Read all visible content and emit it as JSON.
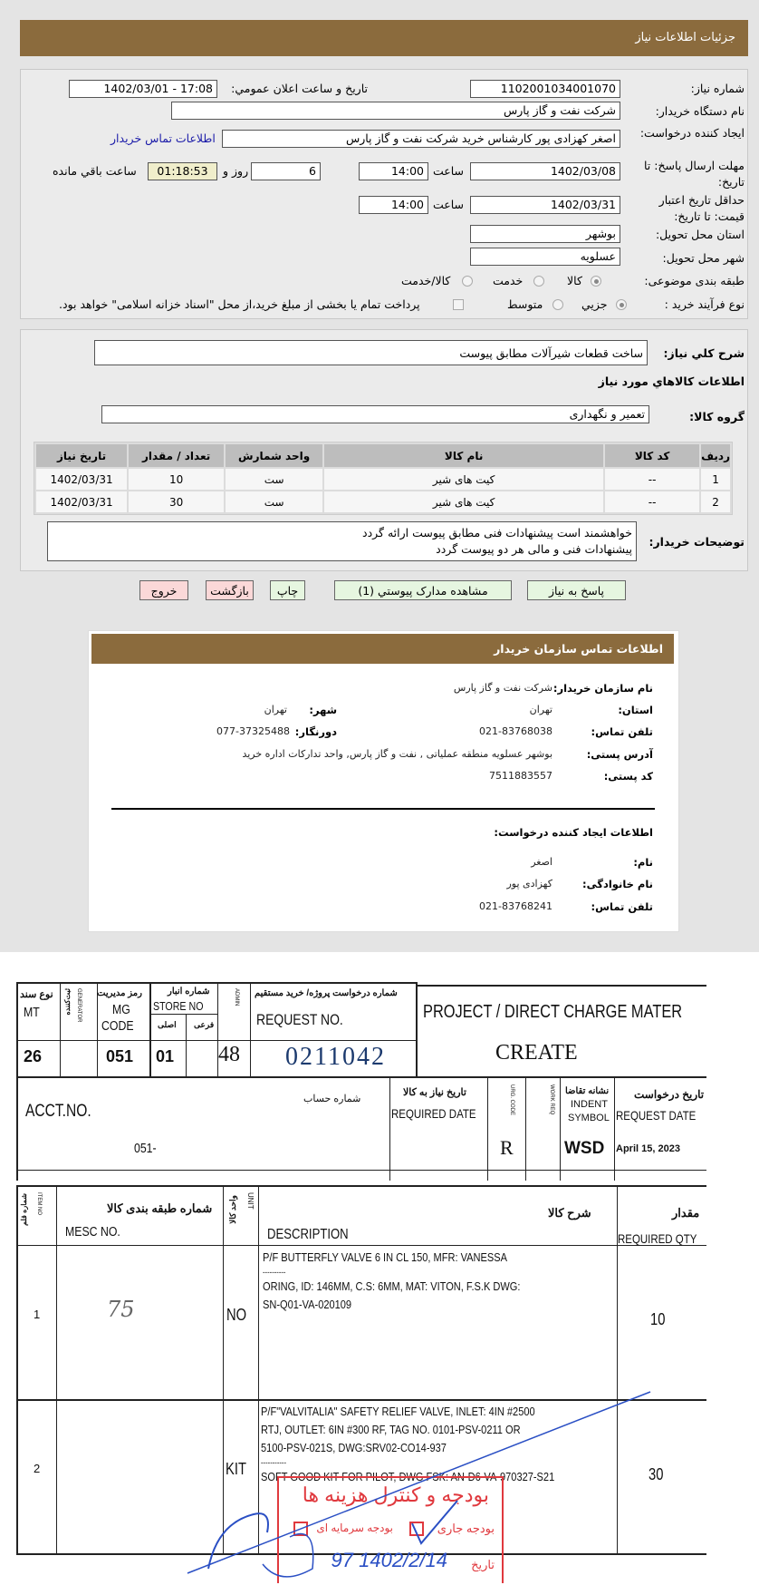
{
  "header": {
    "title": "جزئیات اطلاعات نیاز"
  },
  "form": {
    "need_number_label": "شماره نیاز:",
    "need_number": "1102001034001070",
    "announce_label": "تاريخ و ساعت اعلان عمومي:",
    "announce_value": "1402/03/01 - 17:08",
    "buyer_label": "نام دستگاه خریدار:",
    "buyer_value": "شرکت نفت و گاز پارس",
    "creator_label": "ایجاد کننده درخواست:",
    "creator_value": "اصغر کهزادی پور کارشناس خرید شرکت نفت و گاز پارس",
    "contact_link": "اطلاعات تماس خریدار",
    "deadline_label": "مهلت ارسال پاسخ: تا تاریخ:",
    "deadline_date": "1402/03/08",
    "time_label": "ساعت",
    "deadline_time": "14:00",
    "days": "6",
    "days_label": "روز و",
    "remaining": "01:18:53",
    "remaining_label": "ساعت باقي مانده",
    "validity_label": "حداقل تاریخ اعتبار قیمت: تا تاریخ:",
    "validity_date": "1402/03/31",
    "validity_time": "14:00",
    "province_label": "استان محل تحویل:",
    "province": "بوشهر",
    "city_label": "شهر محل تحویل:",
    "city": "عسلویه",
    "category_label": "طبقه بندی موضوعی:",
    "category_options": [
      "کالا",
      "خدمت",
      "کالا/خدمت"
    ],
    "category_selected": "کالا",
    "process_label": "نوع فرآیند خرید :",
    "process_options": [
      "جزيي",
      "متوسط"
    ],
    "process_selected": "جزيي",
    "treasury_note": "پرداخت تمام یا بخشی از مبلغ خرید،از محل \"اسناد خزانه اسلامی\" خواهد بود."
  },
  "details": {
    "summary_label": "شرح كلي نياز:",
    "summary": "ساخت قطعات شیرآلات مطابق پیوست",
    "goods_heading": "اطلاعات كالاهاي مورد نياز",
    "group_label": "گروه کالا:",
    "group": "تعمیر و نگهداری",
    "table": {
      "headers": [
        "رديف",
        "کد کالا",
        "نام کالا",
        "واحد شمارش",
        "تعداد / مقدار",
        "تاریخ نیاز"
      ],
      "rows": [
        [
          "1",
          "--",
          "کیت های شیر",
          "ست",
          "10",
          "1402/03/31"
        ],
        [
          "2",
          "--",
          "کیت های شیر",
          "ست",
          "30",
          "1402/03/31"
        ]
      ]
    },
    "notes_label": "توضیحات خریدار:",
    "notes": [
      "خواهشمند است پیشنهادات فنی مطابق پیوست ارائه گردد",
      "پیشنهادات فنی و مالی هر دو پیوست گردد"
    ]
  },
  "buttons": {
    "reply": "پاسخ به نياز",
    "attachments": "مشاهده مدارک پيوستي (1)",
    "print": "چاپ",
    "back": "بازگشت",
    "exit": "خروج"
  },
  "contact": {
    "title": "اطلاعات تماس سازمان خریدار",
    "org_label": "نام سازمان خریدار:",
    "org": "شرکت نفت و گاز پارس",
    "province_label": "استان:",
    "province": "تهران",
    "city_label": "شهر:",
    "city": "تهران",
    "phone_label": "تلفن تماس:",
    "phone": "021-83768038",
    "fax_label": "دورنگار:",
    "fax": "077-37325488",
    "address_label": "آدرس پستی:",
    "address": "بوشهر عسلویه منطقه عملیاتی , نفت و گاز پارس, واحد تدارکات اداره خرید",
    "postal_label": "کد پستی:",
    "postal": "7511883557",
    "creator_heading": "اطلاعات ایجاد کننده درخواست:",
    "name_label": "نام:",
    "name": "اصغر",
    "family_label": "نام خانوادگی:",
    "family": "کهزادی پور",
    "creator_phone_label": "تلفن تماس:",
    "creator_phone": "021-83768241"
  },
  "document": {
    "doc_type_fa": "نوع سند",
    "doc_type_en": "MT",
    "doc_type": "26",
    "generator_fa": "ثبت‌کننده",
    "generator_en": "GENERATOR",
    "mg_fa": "رمز مدیریت",
    "mg_en1": "MG",
    "mg_en2": "CODE",
    "mg": "051",
    "store_fa": "شماره انبار",
    "store_en": "STORE NO",
    "store_main": "اصلی",
    "store_sub": "فرعی",
    "store": "01",
    "admin_fa": "رمز مدیریت",
    "admin_en": "ADMIN",
    "admin": "48",
    "request_fa": "شماره درخواست پروژه/ خرید مستقیم",
    "request_en": "REQUEST NO.",
    "request": "0211042",
    "form_title": "PROJECT / DIRECT CHARGE MATER",
    "action": "CREATE",
    "acct_en": "ACCT.NO.",
    "acct_fa": "شماره حساب",
    "acct": "051-",
    "req_date_fa": "تاریخ نیاز به کالا",
    "req_date_en": "REQUIRED DATE",
    "urg_en": "URG. CODE",
    "urg": "R",
    "work_en": "WORK REQ",
    "indent_fa": "نشانه تقاضا",
    "indent_en1": "INDENT",
    "indent_en2": "SYMBOL",
    "indent": "WSD",
    "request_date_fa": "تاریخ درخواست",
    "request_date_en": "REQUEST DATE",
    "request_date": "April 15, 2023",
    "col_item_en": "ITEM NO",
    "col_item_fa": "شماره قلم",
    "col_mesc_fa": "شماره طبقه بندی کالا",
    "col_mesc_en": "MESC NO.",
    "col_unit_fa": "واحد کالا",
    "col_unit_en": "UNIT",
    "col_desc_fa": "شرح کالا",
    "col_desc_en": "DESCRIPTION",
    "col_qty_fa": "مقدار",
    "col_qty_en": "REQUIRED QTY",
    "rows": [
      {
        "item": "1",
        "mesc": "75",
        "unit": "NO",
        "qty": "10",
        "desc": [
          "P/F BUTTERFLY VALVE 6 IN CL 150, MFR: VANESSA",
          "----------",
          "ORING, ID: 146MM, C.S: 6MM, MAT: VITON, F.S.K DWG:",
          "SN-Q01-VA-020109"
        ]
      },
      {
        "item": "2",
        "mesc": "",
        "unit": "KIT",
        "qty": "30",
        "desc": [
          "P/F\"VALVITALIA\"  SAFETY RELIEF VALVE, INLET: 4IN #2500",
          "RTJ, OUTLET: 6IN #300 RF, TAG NO. 0101-PSV-0211 OR",
          "5100-PSV-021S, DWG:SRV02-CO14-937",
          "-----------",
          "SOFT GOOD KIT FOR PILOT, DWG FSK: AN-D6-VA-970327-S21"
        ]
      }
    ],
    "stamp_title": "بودجه و کنترل هزینه ها",
    "stamp_capital": "بودجه سرمایه ای",
    "stamp_current": "بودجه جاری",
    "stamp_date_label": "تاریخ",
    "stamp_date": "97  1402/2/14"
  },
  "colors": {
    "header_brown": "#8b6b3d",
    "link": "#1a1aa8",
    "countdown_bg": "#f0eecb",
    "btn_green": "#e6f6e0",
    "btn_pink": "#fbd8d8",
    "stamp_red": "#e0393e",
    "ink_blue": "#2a4fc4"
  }
}
